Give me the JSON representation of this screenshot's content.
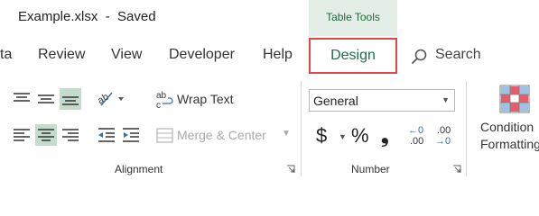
{
  "window": {
    "document_title": "Example.xlsx  -  Saved",
    "context_tab_group": "Table Tools"
  },
  "tabs": [
    {
      "label": "ta"
    },
    {
      "label": "Review"
    },
    {
      "label": "View"
    },
    {
      "label": "Developer"
    },
    {
      "label": "Help"
    },
    {
      "label": "Design",
      "active": true
    }
  ],
  "search": {
    "label": "Search",
    "icon": "search-icon"
  },
  "alignment": {
    "group_label": "Alignment",
    "wrap_text": "Wrap Text",
    "merge_center": "Merge & Center",
    "orientation_glyph": "ab"
  },
  "number": {
    "group_label": "Number",
    "format_value": "General",
    "currency_symbol": "$",
    "percent_symbol": "%",
    "comma_symbol": "❟",
    "increase_decimal_top": "←0",
    "increase_decimal_bottom": ".00",
    "decrease_decimal_top": ".00",
    "decrease_decimal_bottom": "→0"
  },
  "styles": {
    "conditional_formatting_line1": "Condition",
    "conditional_formatting_line2": "Formatting"
  },
  "colors": {
    "accent_green": "#1e7145",
    "active_button_bg": "#c5dccd",
    "highlight_border": "#e04747",
    "context_group_bg": "#e3efe6"
  }
}
